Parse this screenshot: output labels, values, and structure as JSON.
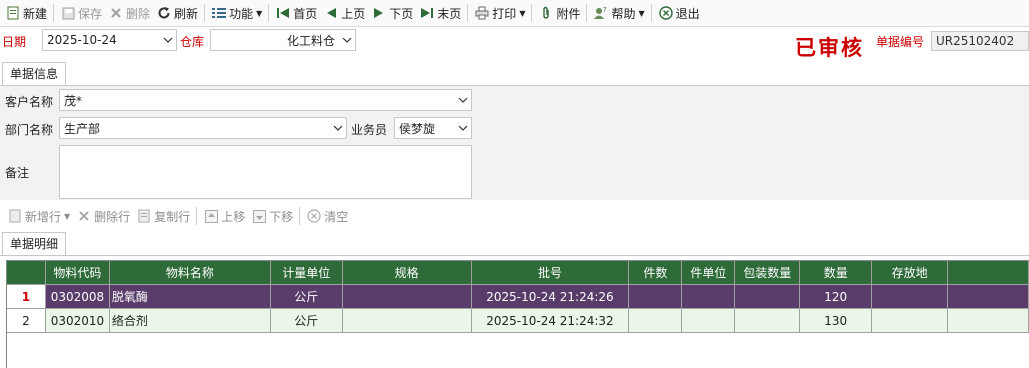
{
  "toolbar": {
    "new": "新建",
    "save": "保存",
    "delete": "删除",
    "refresh": "刷新",
    "function": "功能",
    "first": "首页",
    "prev": "上页",
    "next": "下页",
    "last": "末页",
    "print": "打印",
    "attach": "附件",
    "help": "帮助",
    "exit": "退出"
  },
  "header": {
    "date_label": "日期",
    "date_value": "2025-10-24",
    "warehouse_label": "仓库",
    "warehouse_value": "化工料仓",
    "status_stamp": "已审核",
    "doc_no_label": "单据编号",
    "doc_no_value": "UR25102402"
  },
  "tabs": {
    "info": "单据信息",
    "detail": "单据明细"
  },
  "info": {
    "customer_label": "客户名称",
    "customer_value": "茂*",
    "dept_label": "部门名称",
    "dept_value": "生产部",
    "salesman_label": "业务员",
    "salesman_value": "侯梦旋",
    "remark_label": "备注",
    "remark_value": ""
  },
  "detail_toolbar": {
    "add_row": "新增行",
    "delete_row": "删除行",
    "copy_row": "复制行",
    "move_up": "上移",
    "move_down": "下移",
    "clear": "清空"
  },
  "grid": {
    "columns": [
      "物料代码",
      "物料名称",
      "计量单位",
      "规格",
      "批号",
      "件数",
      "件单位",
      "包装数量",
      "数量",
      "存放地"
    ],
    "rows": [
      {
        "num": "1",
        "code": "0302008",
        "name": "脱氧酶",
        "unit": "公斤",
        "spec": "",
        "batch": "2025-10-24 21:24:26",
        "pieces": "",
        "piece_unit": "",
        "pack_qty": "",
        "qty": "120",
        "location": ""
      },
      {
        "num": "2",
        "code": "0302010",
        "name": "络合剂",
        "unit": "公斤",
        "spec": "",
        "batch": "2025-10-24 21:24:32",
        "pieces": "",
        "piece_unit": "",
        "pack_qty": "",
        "qty": "130",
        "location": ""
      }
    ]
  },
  "colors": {
    "grid_header": "#2e6b39",
    "selected_row": "#5a3c6b",
    "alt_row": "#eaf6e7",
    "required_label": "#cc0000"
  }
}
